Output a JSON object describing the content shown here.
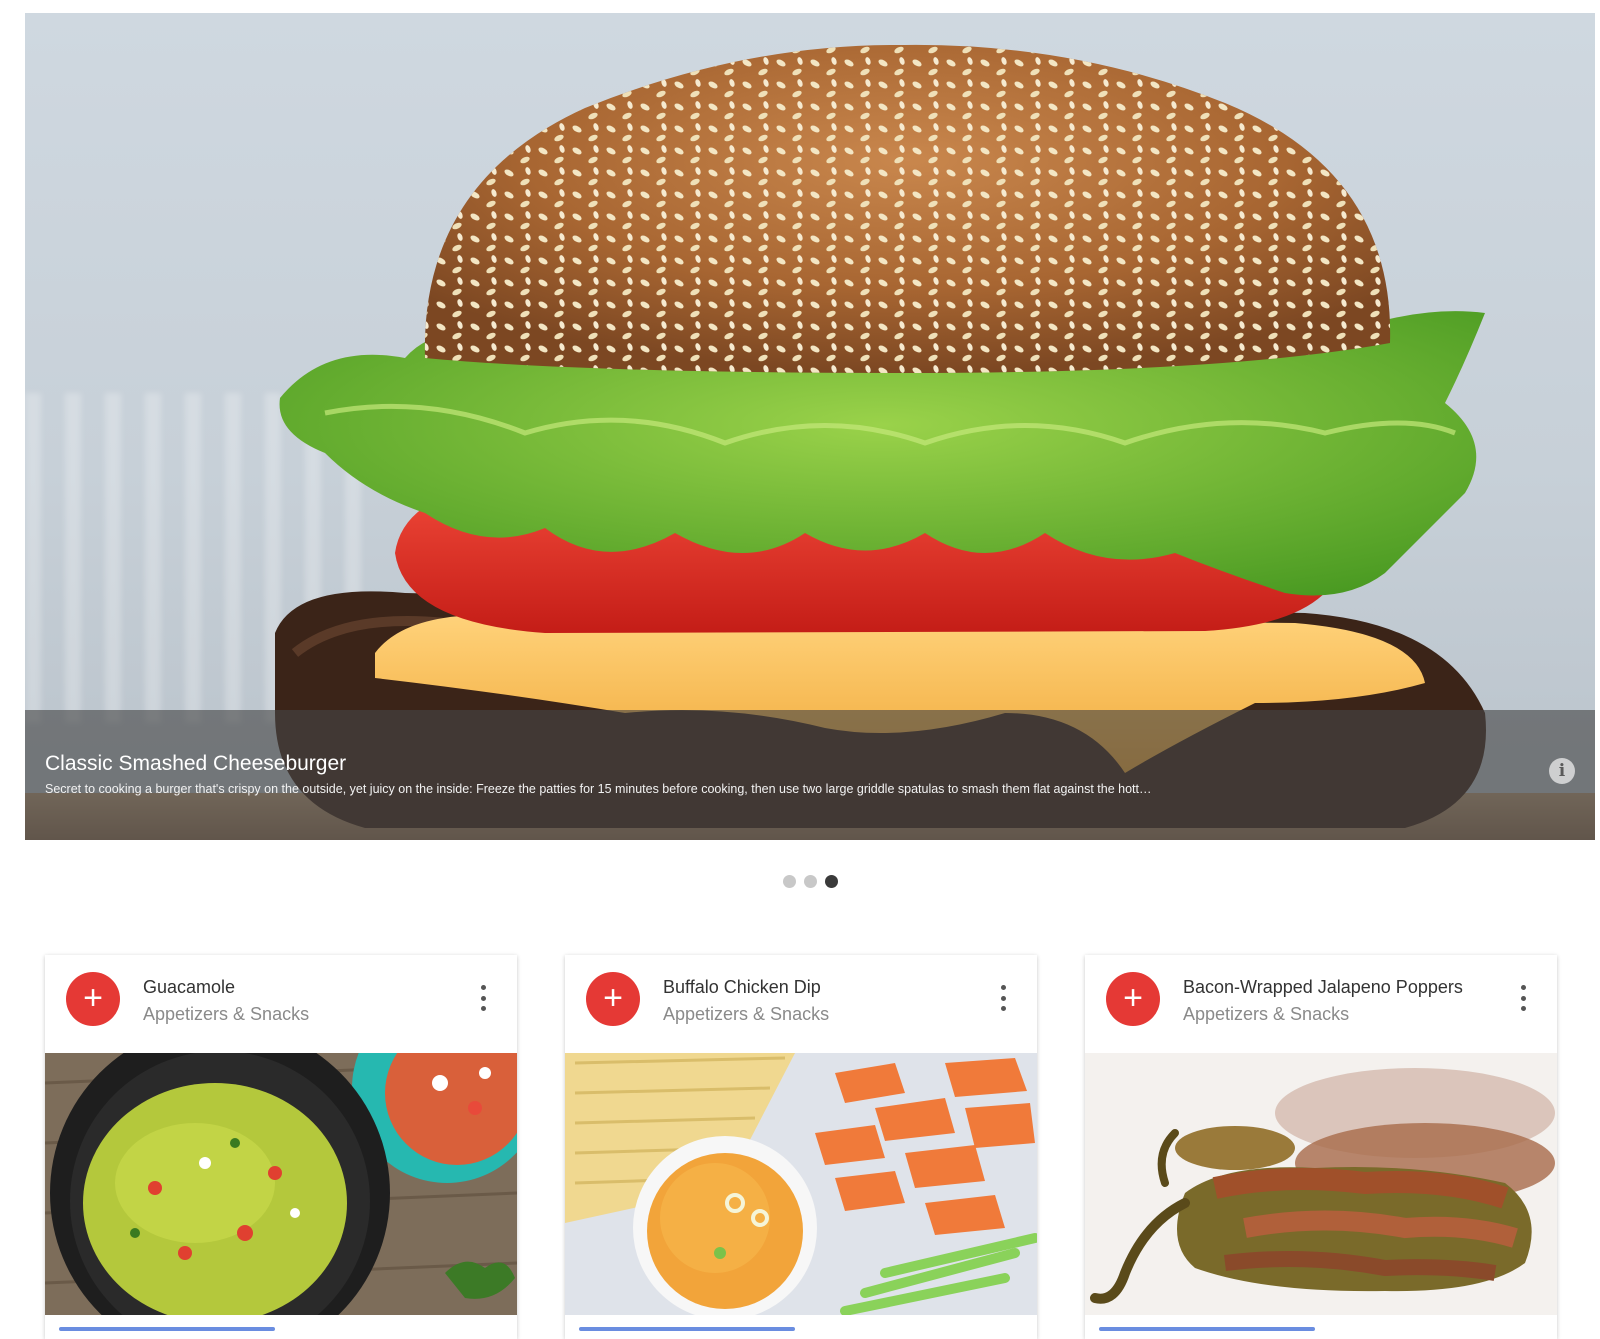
{
  "carousel": {
    "title": "Classic Smashed Cheeseburger",
    "description": "Secret to cooking a burger that's crispy on the outside, yet juicy on the inside: Freeze the patties for 15 minutes before cooking, then use two large griddle spatulas to smash them flat against the hott…",
    "info_icon": "info-icon",
    "slide_count": 3,
    "active_slide": 3
  },
  "cards": [
    {
      "title": "Guacamole",
      "subtitle": "Appetizers & Snacks",
      "action_icon": "plus-icon",
      "menu_icon": "more-vert-icon",
      "image": "guacamole-photo"
    },
    {
      "title": "Buffalo Chicken Dip",
      "subtitle": "Appetizers & Snacks",
      "action_icon": "plus-icon",
      "menu_icon": "more-vert-icon",
      "image": "buffalo-chicken-dip-photo"
    },
    {
      "title": "Bacon-Wrapped Jalapeno Poppers",
      "subtitle": "Appetizers & Snacks",
      "action_icon": "plus-icon",
      "menu_icon": "more-vert-icon",
      "image": "jalapeno-poppers-photo"
    }
  ],
  "colors": {
    "accent_red": "#e53935",
    "caption_overlay": "#464646",
    "dot_active": "#3a3a3a",
    "dot_inactive": "#c8c8c8"
  }
}
